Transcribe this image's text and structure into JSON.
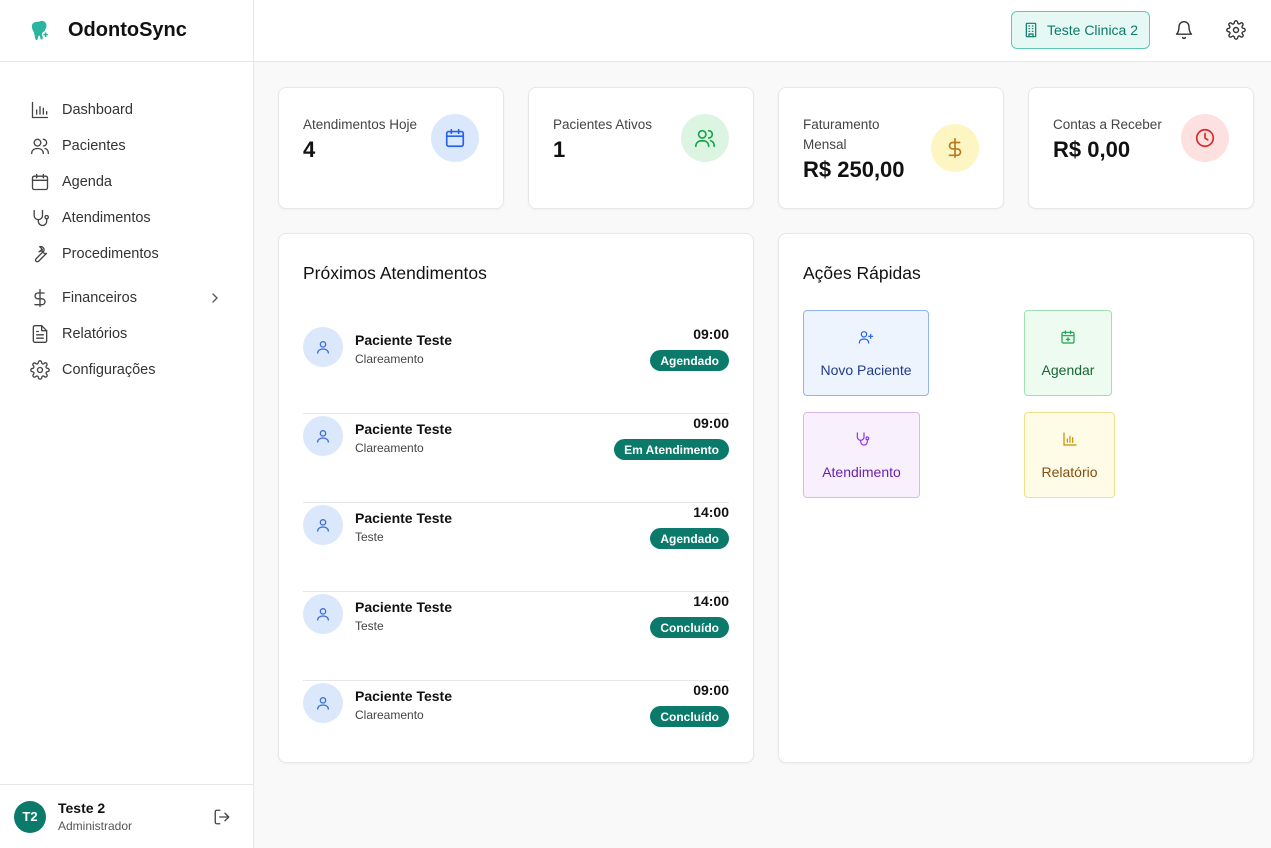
{
  "app": {
    "name": "OdontoSync"
  },
  "sidebar": {
    "items": [
      {
        "label": "Dashboard",
        "icon": "bar-chart-icon"
      },
      {
        "label": "Pacientes",
        "icon": "users-icon"
      },
      {
        "label": "Agenda",
        "icon": "calendar-icon"
      },
      {
        "label": "Atendimentos",
        "icon": "stethoscope-icon"
      },
      {
        "label": "Procedimentos",
        "icon": "wrench-icon"
      },
      {
        "label": "Financeiros",
        "icon": "dollar-icon"
      },
      {
        "label": "Relatórios",
        "icon": "file-text-icon"
      },
      {
        "label": "Configurações",
        "icon": "gear-icon"
      }
    ]
  },
  "user": {
    "initials": "T2",
    "name": "Teste 2",
    "role": "Administrador"
  },
  "header": {
    "clinic": "Teste Clinica 2"
  },
  "stats": [
    {
      "label": "Atendimentos Hoje",
      "value": "4",
      "color": "#2563eb",
      "bg": "#dbe8fb"
    },
    {
      "label": "Pacientes Ativos",
      "value": "1",
      "color": "#16a34a",
      "bg": "#dcf5e3"
    },
    {
      "label": "Faturamento Mensal",
      "value": "R$ 250,00",
      "color": "#b7791f",
      "bg": "#fdf6c3"
    },
    {
      "label": "Contas a Receber",
      "value": "R$ 0,00",
      "color": "#dc2626",
      "bg": "#fde0e0"
    }
  ],
  "appointments": {
    "title": "Próximos Atendimentos",
    "items": [
      {
        "name": "Paciente Teste",
        "procedure": "Clareamento",
        "time": "09:00",
        "status": "Agendado"
      },
      {
        "name": "Paciente Teste",
        "procedure": "Clareamento",
        "time": "09:00",
        "status": "Em Atendimento"
      },
      {
        "name": "Paciente Teste",
        "procedure": "Teste",
        "time": "14:00",
        "status": "Agendado"
      },
      {
        "name": "Paciente Teste",
        "procedure": "Teste",
        "time": "14:00",
        "status": "Concluído"
      },
      {
        "name": "Paciente Teste",
        "procedure": "Clareamento",
        "time": "09:00",
        "status": "Concluído"
      }
    ]
  },
  "quick_actions": {
    "title": "Ações Rápidas",
    "items": [
      {
        "label": "Novo Paciente",
        "color": "#1e3a8a",
        "bg": "#eef4fd",
        "border": "#93b4ec"
      },
      {
        "label": "Agendar",
        "color": "#166534",
        "bg": "#eefbf1",
        "border": "#9ee0b2"
      },
      {
        "label": "Atendimento",
        "color": "#6b21a8",
        "bg": "#f8f1fd",
        "border": "#d8b8f0"
      },
      {
        "label": "Relatório",
        "color": "#854d0e",
        "bg": "#fefbe6",
        "border": "#f1e08a"
      }
    ]
  }
}
